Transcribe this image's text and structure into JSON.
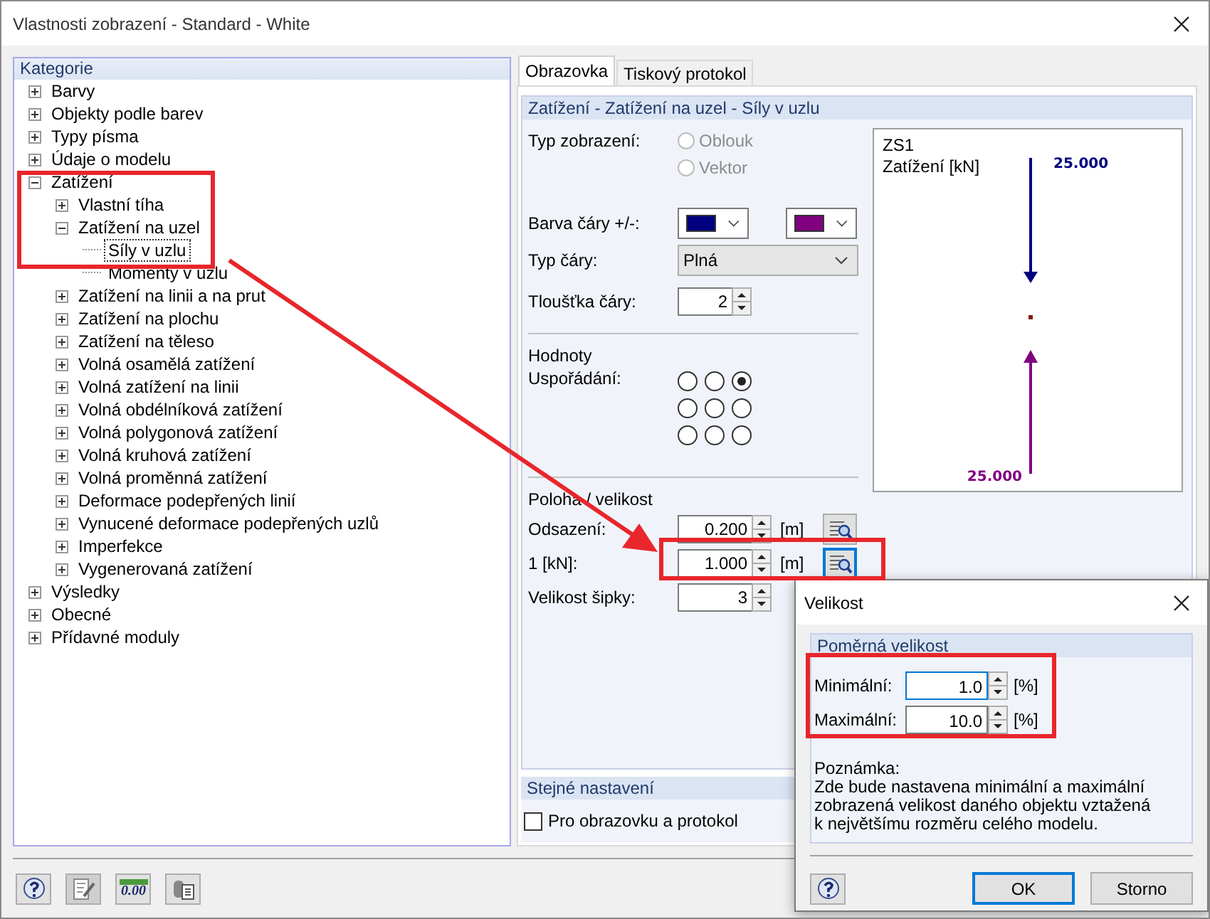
{
  "window": {
    "title": "Vlastnosti zobrazení - Standard - White"
  },
  "categories": {
    "title": "Kategorie",
    "items": [
      {
        "label": "Barvy",
        "expanded": false,
        "selected": false
      },
      {
        "label": "Objekty podle barev",
        "expanded": false,
        "selected": false
      },
      {
        "label": "Typy písma",
        "expanded": false,
        "selected": false
      },
      {
        "label": "Údaje o modelu",
        "expanded": false,
        "selected": false
      },
      {
        "label": "Zatížení",
        "expanded": true,
        "selected": false,
        "children": [
          {
            "label": "Vlastní tíha",
            "expanded": false,
            "selected": false
          },
          {
            "label": "Zatížení na uzel",
            "expanded": true,
            "selected": false,
            "children": [
              {
                "label": "Síly v uzlu",
                "selected": true
              },
              {
                "label": "Momenty v uzlu",
                "selected": false
              }
            ]
          },
          {
            "label": "Zatížení na linii a na prut",
            "expanded": false,
            "selected": false
          },
          {
            "label": "Zatížení na plochu",
            "expanded": false,
            "selected": false
          },
          {
            "label": "Zatížení na těleso",
            "expanded": false,
            "selected": false
          },
          {
            "label": "Volná osamělá zatížení",
            "expanded": false,
            "selected": false
          },
          {
            "label": "Volná zatížení na linii",
            "expanded": false,
            "selected": false
          },
          {
            "label": "Volná obdélníková zatížení",
            "expanded": false,
            "selected": false
          },
          {
            "label": "Volná polygonová zatížení",
            "expanded": false,
            "selected": false
          },
          {
            "label": "Volná kruhová zatížení",
            "expanded": false,
            "selected": false
          },
          {
            "label": "Volná proměnná zatížení",
            "expanded": false,
            "selected": false
          },
          {
            "label": "Deformace podepřených linií",
            "expanded": false,
            "selected": false
          },
          {
            "label": "Vynucené deformace podepřených uzlů",
            "expanded": false,
            "selected": false
          },
          {
            "label": "Imperfekce",
            "expanded": false,
            "selected": false
          },
          {
            "label": "Vygenerovaná zatížení",
            "expanded": false,
            "selected": false
          }
        ]
      },
      {
        "label": "Výsledky",
        "expanded": false,
        "selected": false
      },
      {
        "label": "Obecné",
        "expanded": false,
        "selected": false
      },
      {
        "label": "Přídavné moduly",
        "expanded": false,
        "selected": false
      }
    ]
  },
  "tabs": [
    {
      "label": "Obrazovka",
      "selected": true
    },
    {
      "label": "Tiskový protokol",
      "selected": false
    }
  ],
  "settings": {
    "title": "Zatížení - Zatížení na uzel - Síly v uzlu",
    "display_type": {
      "label": "Typ zobrazení:",
      "options": [
        {
          "label": "Oblouk",
          "selected": false,
          "disabled": true
        },
        {
          "label": "Vektor",
          "selected": false,
          "disabled": true
        }
      ]
    },
    "line_color": {
      "label": "Barva čáry +/-:",
      "swatches": [
        {
          "color": "#000080"
        },
        {
          "color": "#800080"
        }
      ]
    },
    "line_type": {
      "label": "Typ čáry:",
      "value": "Plná"
    },
    "line_width": {
      "label": "Tloušťka čáry:",
      "value": "2"
    },
    "values_title": "Hodnoty",
    "arrangement": {
      "label": "Uspořádání:",
      "options": [
        {
          "selected": false
        },
        {
          "selected": false
        },
        {
          "selected": true
        },
        {
          "selected": false
        },
        {
          "selected": false
        },
        {
          "selected": false
        },
        {
          "selected": false
        },
        {
          "selected": false
        },
        {
          "selected": false
        }
      ]
    },
    "position_title": "Poloha / velikost",
    "position_rows": [
      {
        "label": "Odsazení:",
        "value": "0.200",
        "unit": "[m]",
        "focused": false
      },
      {
        "label": "1 [kN]:",
        "value": "1.000",
        "unit": "[m]",
        "focused": true
      }
    ],
    "arrow_size": {
      "label": "Velikost šipky:",
      "value": "3"
    }
  },
  "preview": {
    "case": "ZS1",
    "caption": "Zatížení [kN]",
    "top_value": "25.000",
    "bottom_value": "25.000"
  },
  "same_settings": {
    "title": "Stejné nastavení",
    "label": "Pro obrazovku a protokol",
    "checked": false
  },
  "toolbar": {
    "number_icon_text": "0.00"
  },
  "dialog": {
    "title": "Velikost",
    "group": "Poměrná velikost",
    "rows": [
      {
        "label": "Minimální:",
        "value": "1.0",
        "unit": "[%]",
        "focused": true
      },
      {
        "label": "Maximální:",
        "value": "10.0",
        "unit": "[%]",
        "focused": false
      }
    ],
    "note_title": "Poznámka:",
    "note": "Zde bude nastavena minimální a maximální zobrazená velikost daného objektu vztažená k největšímu rozměru celého modelu.",
    "ok": "OK",
    "cancel": "Storno"
  }
}
